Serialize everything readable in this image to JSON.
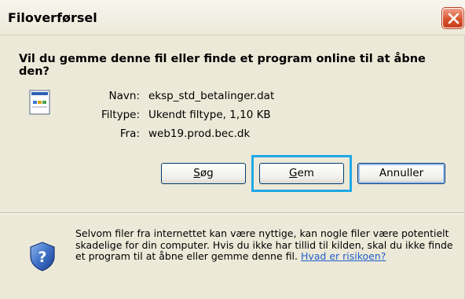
{
  "dialog": {
    "title": "Filoverførsel",
    "question": "Vil du gemme denne fil eller finde et program online til at åbne den?",
    "file": {
      "name_label": "Navn:",
      "name_value": "eksp_std_betalinger.dat",
      "type_label": "Filtype:",
      "type_value": "Ukendt filtype, 1,10 KB",
      "from_label": "Fra:",
      "from_value": "web19.prod.bec.dk"
    },
    "buttons": {
      "search": {
        "label": "Søg",
        "accel": "S",
        "rest": "øg"
      },
      "save": {
        "label": "Gem",
        "accel": "G",
        "rest": "em"
      },
      "cancel": {
        "label": "Annuller"
      }
    },
    "warning": {
      "text": "Selvom filer fra internettet kan være nyttige, kan nogle filer være potentielt skadelige for din computer. Hvis du ikke har tillid til kilden, skal du ikke finde et program til at åbne eller gemme denne fil.",
      "link": "Hvad er risikoen?"
    }
  },
  "icons": {
    "close": "close-icon",
    "file": "unknown-file-icon",
    "shield": "security-shield-icon"
  },
  "colors": {
    "highlight": "#1ea8e6",
    "close_button": "#d9542e",
    "link": "#1f5fcc"
  }
}
